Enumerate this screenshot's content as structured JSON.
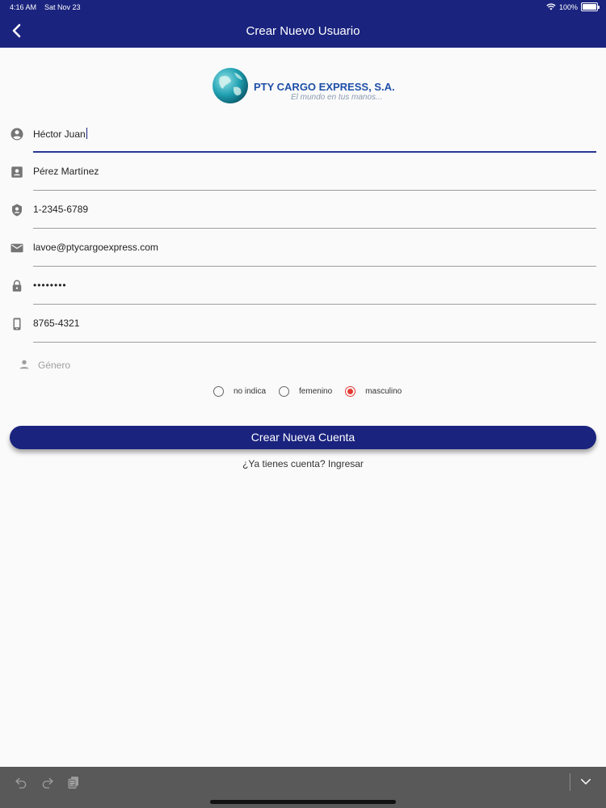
{
  "status": {
    "time": "4:16 AM",
    "date": "Sat Nov 23",
    "battery": "100%"
  },
  "nav": {
    "title": "Crear Nuevo Usuario"
  },
  "logo": {
    "name": "PTY CARGO EXPRESS, S.A.",
    "tagline": "El mundo en tus manos..."
  },
  "form": {
    "first_name": "Héctor Juan",
    "last_name": "Pérez Martínez",
    "id_number": "1-2345-6789",
    "email": "lavoe@ptycargoexpress.com",
    "password": "••••••••",
    "phone": "8765-4321",
    "gender_label": "Género",
    "gender_options": [
      "no indica",
      "femenino",
      "masculino"
    ],
    "gender_selected": "masculino"
  },
  "actions": {
    "create_account": "Crear Nueva Cuenta",
    "login_prompt": "¿Ya tienes cuenta? Ingresar"
  },
  "colors": {
    "primary": "#1a237e",
    "radio_selected": "#e53935"
  }
}
